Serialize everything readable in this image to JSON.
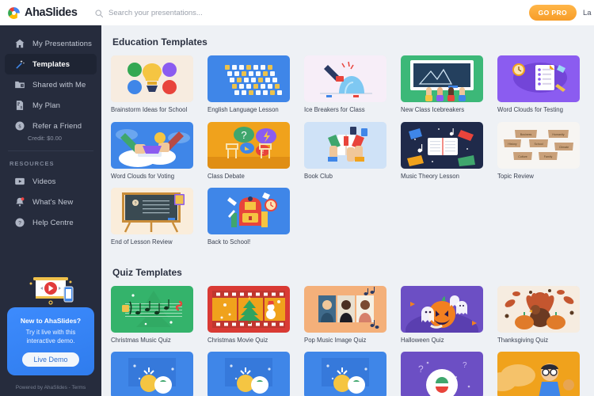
{
  "topbar": {
    "logo_text": "AhaSlides",
    "logo_icon": "ahaslides-logo-icon",
    "search_icon": "search-icon",
    "search_value": "",
    "search_placeholder": "Search your presentations...",
    "gopro_label": "GO PRO",
    "lang_label": "La"
  },
  "sidebar": {
    "items": [
      {
        "label": "My Presentations",
        "icon": "home-icon",
        "active": false
      },
      {
        "label": "Templates",
        "icon": "magic-wand-icon",
        "active": true
      },
      {
        "label": "Shared with Me",
        "icon": "folder-shared-icon",
        "active": false
      },
      {
        "label": "My Plan",
        "icon": "plan-document-icon",
        "active": false
      },
      {
        "label": "Refer a Friend",
        "icon": "dollar-coin-icon",
        "active": false,
        "sub": "Credit: $0.00"
      }
    ],
    "resources_label": "RESOURCES",
    "resources": [
      {
        "label": "Videos",
        "icon": "video-icon"
      },
      {
        "label": "What's New",
        "icon": "bell-notification-icon"
      },
      {
        "label": "Help Centre",
        "icon": "question-circle-icon"
      }
    ],
    "promo": {
      "art_icon": "projector-play-icon",
      "title": "New to AhaSlides?",
      "body": "Try it live with this interactive demo.",
      "button_label": "Live Demo"
    },
    "footer": "Powered by AhaSlides - Terms"
  },
  "main": {
    "sections": [
      {
        "title": "Education Templates",
        "cards": [
          {
            "label": "Brainstorm Ideas for School",
            "art": "brainstorm",
            "bg": "#f7ece0"
          },
          {
            "label": "English Language Lesson",
            "art": "alphabet",
            "bg": "#3f86e8"
          },
          {
            "label": "Ice Breakers for Class",
            "art": "icebreaker",
            "bg": "#f7eef8"
          },
          {
            "label": "New Class Icebreakers",
            "art": "chalkboard-hands",
            "bg": "#3cb878"
          },
          {
            "label": "Word Clouds for Testing",
            "art": "wordcloud-test",
            "bg": "#8b5cf0"
          },
          {
            "label": "Word Clouds for Voting",
            "art": "cloud-hands",
            "bg": "#3f86e8"
          },
          {
            "label": "Class Debate",
            "art": "debate",
            "bg": "#f0a21c"
          },
          {
            "label": "Book Club",
            "art": "bookclub",
            "bg": "#cfe2f7"
          },
          {
            "label": "Music Theory Lesson",
            "art": "music-book",
            "bg": "#1f2a4a"
          },
          {
            "label": "Topic Review",
            "art": "topic-tags",
            "bg": "#f7f5f2"
          },
          {
            "label": "End of Lesson Review",
            "art": "blackboard",
            "bg": "#faeddb"
          },
          {
            "label": "Back to School!",
            "art": "backpack",
            "bg": "#3f86e8"
          }
        ]
      },
      {
        "title": "Quiz Templates",
        "cards": [
          {
            "label": "Christmas Music Quiz",
            "art": "xmas-music",
            "bg": "#34b36b"
          },
          {
            "label": "Christmas Movie Quiz",
            "art": "xmas-movie",
            "bg": "#d93a34"
          },
          {
            "label": "Pop Music Image Quiz",
            "art": "pop-music",
            "bg": "#f4b07a"
          },
          {
            "label": "Halloween Quiz",
            "art": "halloween",
            "bg": "#6c4fc4"
          },
          {
            "label": "Thanksgiving Quiz",
            "art": "thanksgiving",
            "bg": "#f6ece0"
          }
        ]
      }
    ],
    "partial_row": [
      {
        "art": "blue-quiz",
        "bg": "#3f86e8"
      },
      {
        "art": "blue-quiz",
        "bg": "#3f86e8"
      },
      {
        "art": "blue-quiz",
        "bg": "#3f86e8"
      },
      {
        "art": "purple-quiz",
        "bg": "#6c4fc4"
      },
      {
        "art": "orange-quiz",
        "bg": "#f0a21c"
      }
    ]
  },
  "colors": {
    "sidebar_bg": "#262c3d",
    "accent_blue": "#3f86e8",
    "gopro_orange": "#f79d29",
    "main_bg": "#eef1f5"
  }
}
